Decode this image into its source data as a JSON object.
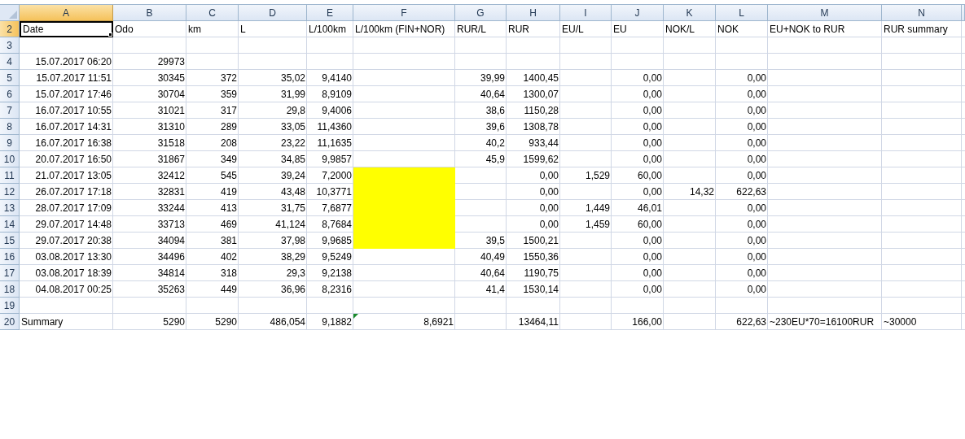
{
  "columns": [
    {
      "letter": "A",
      "selected": true
    },
    {
      "letter": "B",
      "selected": false
    },
    {
      "letter": "C",
      "selected": false
    },
    {
      "letter": "D",
      "selected": false
    },
    {
      "letter": "E",
      "selected": false
    },
    {
      "letter": "F",
      "selected": false
    },
    {
      "letter": "G",
      "selected": false
    },
    {
      "letter": "H",
      "selected": false
    },
    {
      "letter": "I",
      "selected": false
    },
    {
      "letter": "J",
      "selected": false
    },
    {
      "letter": "K",
      "selected": false
    },
    {
      "letter": "L",
      "selected": false
    },
    {
      "letter": "M",
      "selected": false
    },
    {
      "letter": "N",
      "selected": false
    }
  ],
  "rows": [
    {
      "number": "2",
      "selected": true,
      "cells": [
        {
          "text": "Date",
          "kind": "label",
          "selected": true
        },
        {
          "text": "Odo",
          "kind": "label"
        },
        {
          "text": "km",
          "kind": "label"
        },
        {
          "text": "L",
          "kind": "label"
        },
        {
          "text": "L/100km",
          "kind": "label"
        },
        {
          "text": "L/100km (FIN+NOR)",
          "kind": "label"
        },
        {
          "text": "RUR/L",
          "kind": "label"
        },
        {
          "text": "RUR",
          "kind": "label"
        },
        {
          "text": "EU/L",
          "kind": "label"
        },
        {
          "text": "EU",
          "kind": "label"
        },
        {
          "text": "NOK/L",
          "kind": "label"
        },
        {
          "text": "NOK",
          "kind": "label"
        },
        {
          "text": "EU+NOK to RUR",
          "kind": "label"
        },
        {
          "text": "RUR summary",
          "kind": "label"
        }
      ]
    },
    {
      "number": "3",
      "selected": false
    },
    {
      "number": "4",
      "selected": false,
      "cells": [
        "15.07.2017 06:20",
        "29973"
      ]
    },
    {
      "number": "5",
      "selected": false,
      "cells": [
        "15.07.2017 11:51",
        "30345",
        "372",
        "35,02",
        "9,4140",
        null,
        "39,99",
        "1400,45",
        null,
        "0,00",
        null,
        "0,00"
      ]
    },
    {
      "number": "6",
      "selected": false,
      "cells": [
        "15.07.2017 17:46",
        "30704",
        "359",
        "31,99",
        "8,9109",
        null,
        "40,64",
        "1300,07",
        null,
        "0,00",
        null,
        "0,00"
      ]
    },
    {
      "number": "7",
      "selected": false,
      "cells": [
        "16.07.2017 10:55",
        "31021",
        "317",
        "29,8",
        "9,4006",
        null,
        "38,6",
        "1150,28",
        null,
        "0,00",
        null,
        "0,00"
      ]
    },
    {
      "number": "8",
      "selected": false,
      "cells": [
        "16.07.2017 14:31",
        "31310",
        "289",
        "33,05",
        "11,4360",
        null,
        "39,6",
        "1308,78",
        null,
        "0,00",
        null,
        "0,00"
      ]
    },
    {
      "number": "9",
      "selected": false,
      "cells": [
        "16.07.2017 16:38",
        "31518",
        "208",
        "23,22",
        "11,1635",
        null,
        "40,2",
        "933,44",
        null,
        "0,00",
        null,
        "0,00"
      ]
    },
    {
      "number": "10",
      "selected": false,
      "cells": [
        "20.07.2017 16:50",
        "31867",
        "349",
        "34,85",
        "9,9857",
        null,
        "45,9",
        "1599,62",
        null,
        "0,00",
        null,
        "0,00"
      ]
    },
    {
      "number": "11",
      "selected": false,
      "cells": [
        "21.07.2017 13:05",
        "32412",
        "545",
        "39,24",
        "7,2000",
        {
          "color": "#ffff00"
        },
        null,
        "0,00",
        "1,529",
        "60,00",
        null,
        "0,00"
      ]
    },
    {
      "number": "12",
      "selected": false,
      "cells": [
        "26.07.2017 17:18",
        "32831",
        "419",
        "43,48",
        "10,3771",
        {
          "color": "#ffff00"
        },
        null,
        "0,00",
        null,
        "0,00",
        "14,32",
        "622,63"
      ]
    },
    {
      "number": "13",
      "selected": false,
      "cells": [
        "28.07.2017 17:09",
        "33244",
        "413",
        "31,75",
        "7,6877",
        {
          "color": "#ffff00"
        },
        null,
        "0,00",
        "1,449",
        "46,01",
        null,
        "0,00"
      ]
    },
    {
      "number": "14",
      "selected": false,
      "cells": [
        "29.07.2017 14:48",
        "33713",
        "469",
        "41,124",
        "8,7684",
        {
          "color": "#ffff00"
        },
        null,
        "0,00",
        "1,459",
        "60,00",
        null,
        "0,00"
      ]
    },
    {
      "number": "15",
      "selected": false,
      "cells": [
        "29.07.2017 20:38",
        "34094",
        "381",
        "37,98",
        "9,9685",
        {
          "color": "#ffff00"
        },
        "39,5",
        "1500,21",
        null,
        "0,00",
        null,
        "0,00"
      ]
    },
    {
      "number": "16",
      "selected": false,
      "cells": [
        "03.08.2017 13:30",
        "34496",
        "402",
        "38,29",
        "9,5249",
        null,
        "40,49",
        "1550,36",
        null,
        "0,00",
        null,
        "0,00"
      ]
    },
    {
      "number": "17",
      "selected": false,
      "cells": [
        "03.08.2017 18:39",
        "34814",
        "318",
        "29,3",
        "9,2138",
        null,
        "40,64",
        "1190,75",
        null,
        "0,00",
        null,
        "0,00"
      ]
    },
    {
      "number": "18",
      "selected": false,
      "cells": [
        "04.08.2017 00:25",
        "35263",
        "449",
        "36,96",
        "8,2316",
        null,
        "41,4",
        "1530,14",
        null,
        "0,00",
        null,
        "0,00"
      ]
    },
    {
      "number": "19",
      "selected": false
    },
    {
      "number": "20",
      "selected": false,
      "cells": [
        {
          "text": "Summary",
          "kind": "label"
        },
        "5290",
        "5290",
        "486,054",
        "9,1882",
        {
          "text": "8,6921",
          "flagged": true
        },
        null,
        "13464,11",
        null,
        "166,00",
        null,
        "622,63",
        {
          "text": "~230EU*70=16100RUR",
          "kind": "label"
        },
        {
          "text": "~30000",
          "kind": "label"
        }
      ]
    }
  ]
}
